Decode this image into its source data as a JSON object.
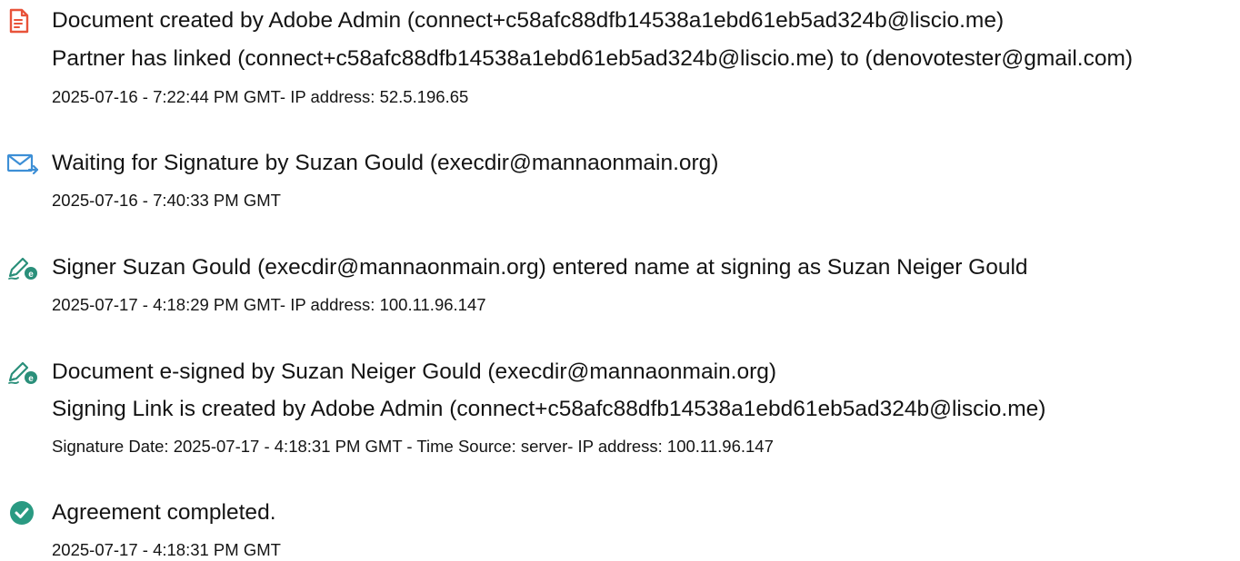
{
  "events": [
    {
      "icon": "document-created-icon",
      "lines": [
        "Document created by Adobe Admin (connect+c58afc88dfb14538a1ebd61eb5ad324b@liscio.me)",
        "Partner has linked (connect+c58afc88dfb14538a1ebd61eb5ad324b@liscio.me) to (denovotester@gmail.com)"
      ],
      "meta": "2025-07-16 - 7:22:44 PM GMT- IP address: 52.5.196.65"
    },
    {
      "icon": "email-sent-icon",
      "lines": [
        "Waiting for Signature by Suzan Gould (execdir@mannaonmain.org)"
      ],
      "meta": "2025-07-16 - 7:40:33 PM GMT"
    },
    {
      "icon": "esign-pen-icon",
      "lines": [
        "Signer Suzan Gould (execdir@mannaonmain.org) entered name at signing as Suzan Neiger Gould"
      ],
      "meta": "2025-07-17 - 4:18:29 PM GMT- IP address: 100.11.96.147"
    },
    {
      "icon": "esign-pen-icon",
      "lines": [
        "Document e-signed by Suzan Neiger Gould (execdir@mannaonmain.org)",
        "Signing Link is created by Adobe Admin (connect+c58afc88dfb14538a1ebd61eb5ad324b@liscio.me)"
      ],
      "meta": "Signature Date: 2025-07-17 - 4:18:31 PM GMT - Time Source: server- IP address: 100.11.96.147"
    },
    {
      "icon": "check-circle-icon",
      "lines": [
        "Agreement completed."
      ],
      "meta": "2025-07-17 - 4:18:31 PM GMT"
    }
  ],
  "colors": {
    "document_icon": "#E8533A",
    "email_icon": "#3D8FD6",
    "pen_icon": "#2A8F7A",
    "check_icon": "#2A9A82",
    "text": "#141414"
  }
}
